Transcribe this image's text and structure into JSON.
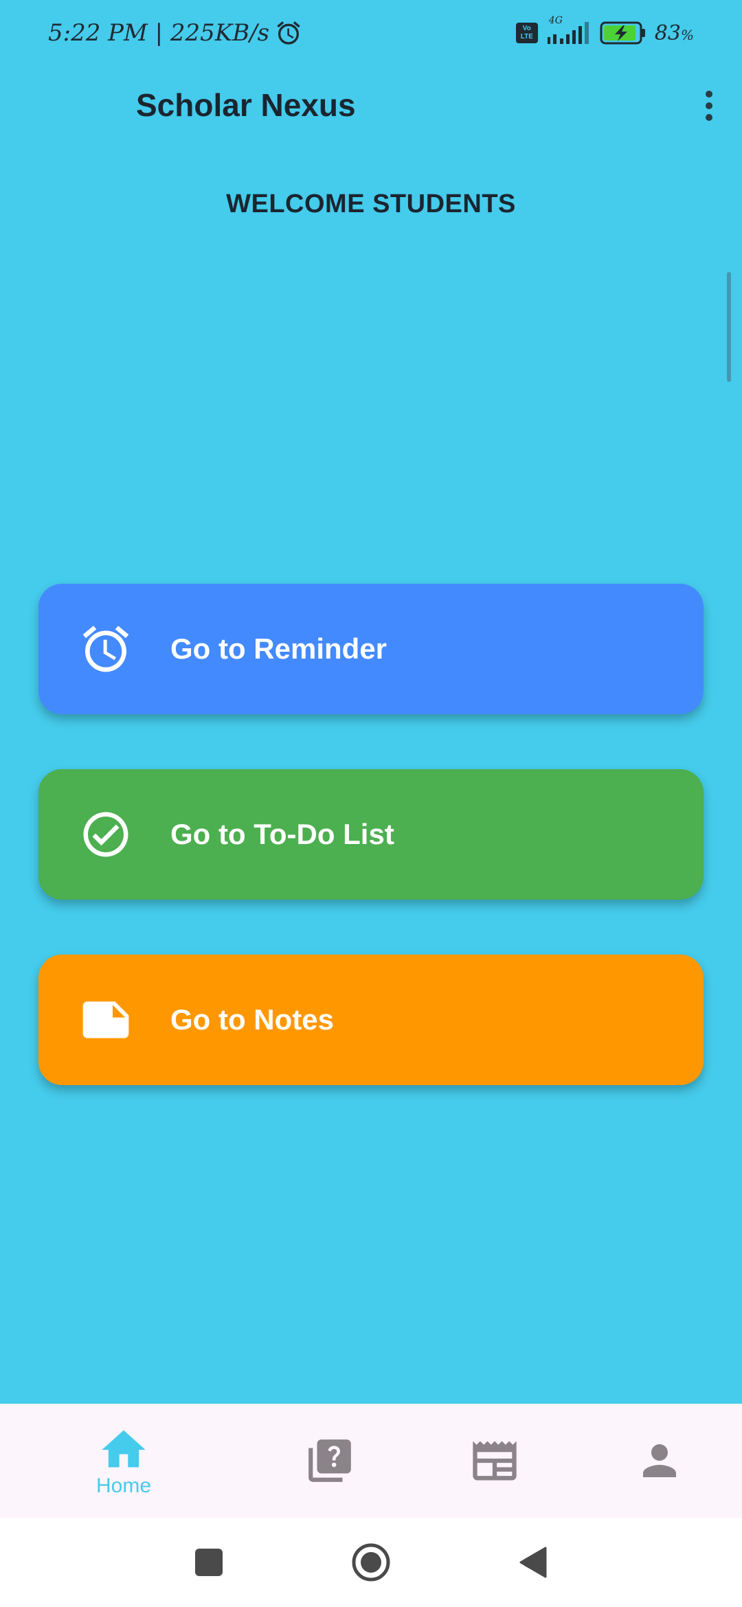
{
  "status_bar": {
    "time_speed": "5:22 PM | 225KB/s",
    "network_type": "4G",
    "volte_label": "Vo LTE",
    "battery_percent": "83",
    "battery_unit": "%"
  },
  "app_bar": {
    "title": "Scholar Nexus"
  },
  "main": {
    "welcome_text": "WELCOME STUDENTS",
    "actions": [
      {
        "label": "Go to Reminder",
        "icon": "alarm-clock-icon",
        "color": "#448AFF"
      },
      {
        "label": "Go to To-Do List",
        "icon": "check-circle-icon",
        "color": "#4CAF50"
      },
      {
        "label": "Go to Notes",
        "icon": "note-icon",
        "color": "#FF9800"
      }
    ]
  },
  "bottom_nav": {
    "items": [
      {
        "label": "Home",
        "icon": "home-icon",
        "active": true
      },
      {
        "label": "",
        "icon": "quiz-icon",
        "active": false
      },
      {
        "label": "",
        "icon": "newspaper-icon",
        "active": false
      },
      {
        "label": "",
        "icon": "person-icon",
        "active": false
      }
    ],
    "active_color": "#45CBEB",
    "inactive_color": "#8a8388"
  },
  "theme": {
    "background": "#45CBEB",
    "nav_background": "#FDF5FC"
  }
}
